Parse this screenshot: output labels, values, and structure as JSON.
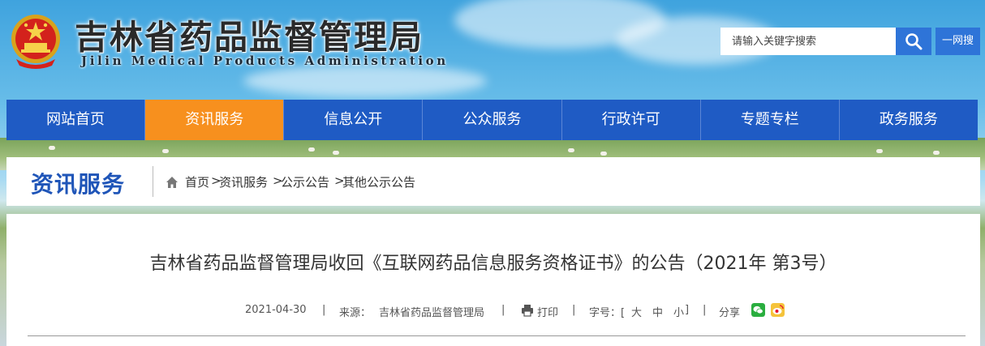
{
  "header": {
    "site_title": "吉林省药品监督管理局",
    "site_subtitle": "Jilin Medical Products Administration",
    "emblem_icon": "national-emblem-icon",
    "search": {
      "placeholder": "请输入关键字搜索",
      "icon": "search-icon"
    },
    "yiwang_label": "一网搜"
  },
  "nav": {
    "items": [
      {
        "label": "网站首页"
      },
      {
        "label": "资讯服务",
        "active": true
      },
      {
        "label": "信息公开"
      },
      {
        "label": "公众服务"
      },
      {
        "label": "行政许可"
      },
      {
        "label": "专题专栏"
      },
      {
        "label": "政务服务"
      }
    ]
  },
  "section": {
    "title": "资讯服务",
    "breadcrumb": {
      "home_icon": "home-icon",
      "items": [
        "首页",
        "资讯服务",
        "公示公告",
        "其他公示公告"
      ],
      "separator": ">"
    }
  },
  "article": {
    "title": "吉林省药品监督管理局收回《互联网药品信息服务资格证书》的公告（2021年 第3号）",
    "date": "2021-04-30",
    "source_label": "来源：",
    "source": "吉林省药品监督管理局",
    "print_label": "打印",
    "print_icon": "printer-icon",
    "fontsize_label": "字号：[",
    "fontsize_large": "大",
    "fontsize_medium": "中",
    "fontsize_small": "小",
    "fontsize_close": "]",
    "share_label": "分享",
    "share_icons": [
      "wechat-icon",
      "weibo-icon"
    ],
    "separator": "|"
  },
  "colors": {
    "nav_blue": "#1f5bc4",
    "nav_active": "#f7901e",
    "section_title": "#1f55b8",
    "search_button": "#2e74d8"
  }
}
